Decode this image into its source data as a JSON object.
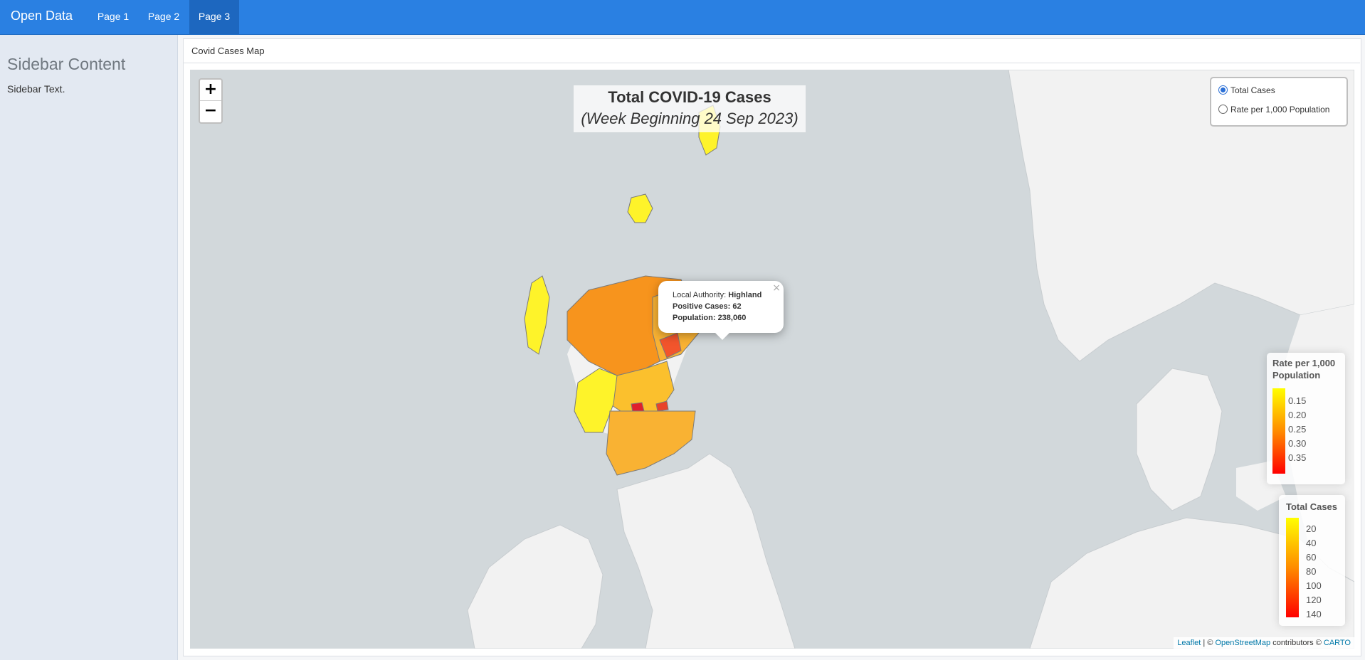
{
  "navbar": {
    "brand": "Open Data",
    "links": [
      {
        "label": "Page 1"
      },
      {
        "label": "Page 2"
      },
      {
        "label": "Page 3",
        "active": true
      }
    ],
    "color": "#2a80e2"
  },
  "sidebar": {
    "title": "Sidebar Content",
    "text": "Sidebar Text."
  },
  "box": {
    "title": "Covid Cases Map"
  },
  "map": {
    "title": "Total COVID-19 Cases",
    "subtitle": "(Week Beginning 24 Sep 2023)",
    "zoom_in": "+",
    "zoom_out": "−",
    "layers": [
      {
        "label": "Total Cases",
        "selected": true
      },
      {
        "label": "Rate per 1,000 Population",
        "selected": false
      }
    ],
    "popup": {
      "la_label": "Local Authority:",
      "la_value": "Highland",
      "cases_label": "Positive Cases:",
      "cases_value": "62",
      "pop_label": "Population:",
      "pop_value": "238,060",
      "close": "×"
    },
    "legend_rate": {
      "title_line1": "Rate per 1,000",
      "title_line2": "Population",
      "ticks": [
        "0.15",
        "0.20",
        "0.25",
        "0.30",
        "0.35"
      ],
      "color_low": "#ffff00",
      "color_high": "#ff0000"
    },
    "legend_total": {
      "title": "Total Cases",
      "ticks": [
        "20",
        "40",
        "60",
        "80",
        "100",
        "120",
        "140"
      ],
      "color_low": "#ffff00",
      "color_high": "#ff0000"
    },
    "attribution": {
      "leaflet": "Leaflet",
      "sep1": " | © ",
      "osm": "OpenStreetMap",
      "sep2": " contributors © ",
      "carto": "CARTO"
    }
  }
}
